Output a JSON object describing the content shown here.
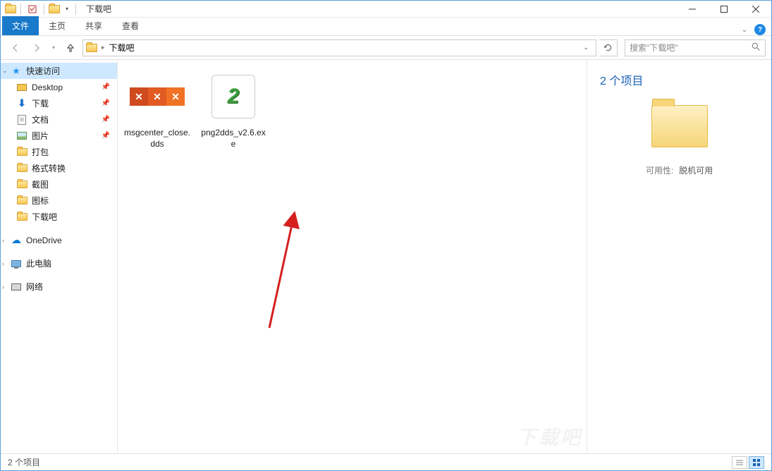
{
  "title": "下载吧",
  "ribbon": {
    "file": "文件",
    "tabs": [
      "主页",
      "共享",
      "查看"
    ]
  },
  "address": {
    "current": "下载吧",
    "search_placeholder": "搜索\"下载吧\""
  },
  "sidebar": {
    "quick_access": "快速访问",
    "items": [
      {
        "label": "Desktop",
        "icon": "desktop",
        "pinned": true
      },
      {
        "label": "下载",
        "icon": "download",
        "pinned": true
      },
      {
        "label": "文档",
        "icon": "doc",
        "pinned": true
      },
      {
        "label": "图片",
        "icon": "pic",
        "pinned": true
      },
      {
        "label": "打包",
        "icon": "folder",
        "pinned": false
      },
      {
        "label": "格式转换",
        "icon": "folder",
        "pinned": false
      },
      {
        "label": "截图",
        "icon": "folder",
        "pinned": false
      },
      {
        "label": "图标",
        "icon": "folder",
        "pinned": false
      },
      {
        "label": "下载吧",
        "icon": "folder",
        "pinned": false
      }
    ],
    "onedrive": "OneDrive",
    "this_pc": "此电脑",
    "network": "网络"
  },
  "files": [
    {
      "name": "msgcenter_close.dds",
      "type": "dds"
    },
    {
      "name": "png2dds_v2.6.exe",
      "type": "exe"
    }
  ],
  "details": {
    "title": "2 个项目",
    "availability_label": "可用性:",
    "availability_value": "脱机可用"
  },
  "statusbar": {
    "count": "2 个项目"
  },
  "watermark": "下载吧"
}
